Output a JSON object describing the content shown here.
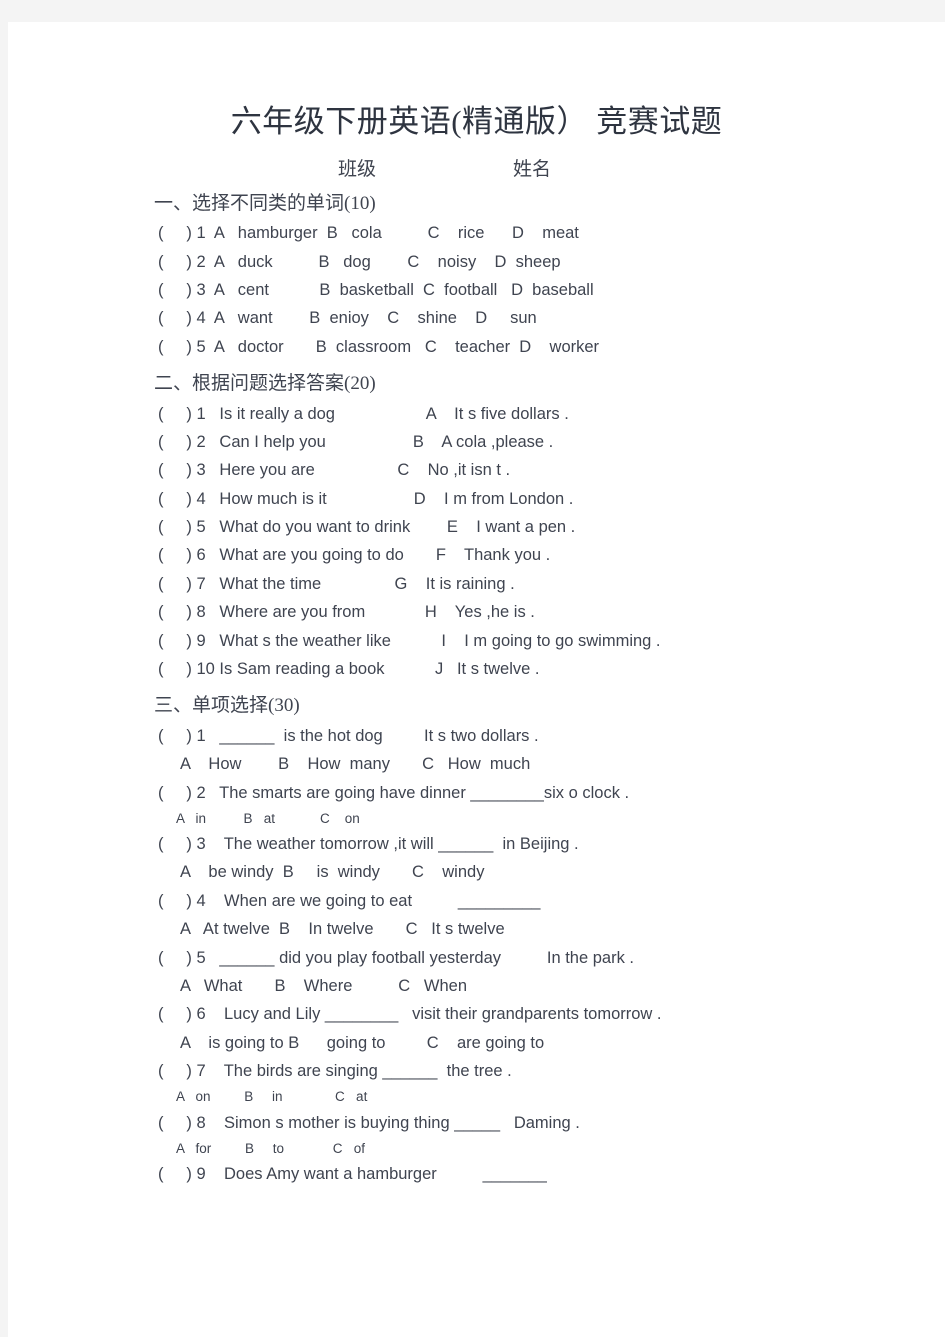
{
  "document": {
    "title": "六年级下册英语(精通版） 竞赛试题",
    "header_fields": {
      "class_label": "班级",
      "name_label": "姓名"
    }
  },
  "sections": [
    {
      "heading": "一、选择不同类的单词(10)",
      "lines": [
        "(     ) 1  A   hamburger  B   cola          C    rice      D    meat",
        "(     ) 2  A   duck          B   dog        C    noisy    D  sheep",
        "(     ) 3  A   cent           B  basketball  C  football   D  baseball",
        "(     ) 4  A   want        B  enioy    C    shine    D     sun",
        "(     ) 5  A   doctor       B  classroom   C    teacher  D    worker"
      ]
    },
    {
      "heading": "二、根据问题选择答案(20)",
      "lines": [
        "(     ) 1   Is it really a dog                    A    It s five dollars .",
        "(     ) 2   Can I help you                   B    A cola ,please .",
        "(     ) 3   Here you are                  C    No ,it isn t .",
        "(     ) 4   How much is it                   D    I m from London .",
        "(     ) 5   What do you want to drink        E    I want a pen .",
        "(     ) 6   What are you going to do       F    Thank you .",
        "(     ) 7   What the time                G    It is raining .",
        "(     ) 8   Where are you from             H    Yes ,he is .",
        "(     ) 9   What s the weather like           I    I m going to go swimming .",
        "(     ) 10 Is Sam reading a book           J   It s twelve ."
      ]
    },
    {
      "heading": "三、单项选择(30)",
      "items": [
        {
          "stem": "(     ) 1   ______  is the hot dog         It s two dollars .",
          "options": "A    How        B    How  many       C   How  much",
          "options_small": false
        },
        {
          "stem": "(     ) 2   The smarts are going have dinner ________six o clock .",
          "options": "A   in          B   at            C    on",
          "options_small": true
        },
        {
          "stem": "(     ) 3    The weather tomorrow ,it will ______  in Beijing .",
          "options": "A    be windy  B     is  windy       C    windy",
          "options_small": false
        },
        {
          "stem": "(     ) 4    When are we going to eat          _________",
          "options": "A   At twelve  B    In twelve       C   It s twelve",
          "options_small": false
        },
        {
          "stem": "(     ) 5   ______ did you play football yesterday          In the park .",
          "options": "A   What       B    Where          C   When",
          "options_small": false
        },
        {
          "stem": "(     ) 6    Lucy and Lily ________   visit their grandparents tomorrow .",
          "options": "A    is going to B      going to         C    are going to",
          "options_small": false
        },
        {
          "stem": "(     ) 7    The birds are singing ______  the tree .",
          "options": "A   on         B     in              C   at",
          "options_small": true
        },
        {
          "stem": "(     ) 8    Simon s mother is buying thing _____   Daming .",
          "options": "A   for         B     to             C   of",
          "options_small": true
        },
        {
          "stem": "(     ) 9    Does Amy want a hamburger          _______",
          "options": "",
          "options_small": false
        }
      ]
    }
  ]
}
